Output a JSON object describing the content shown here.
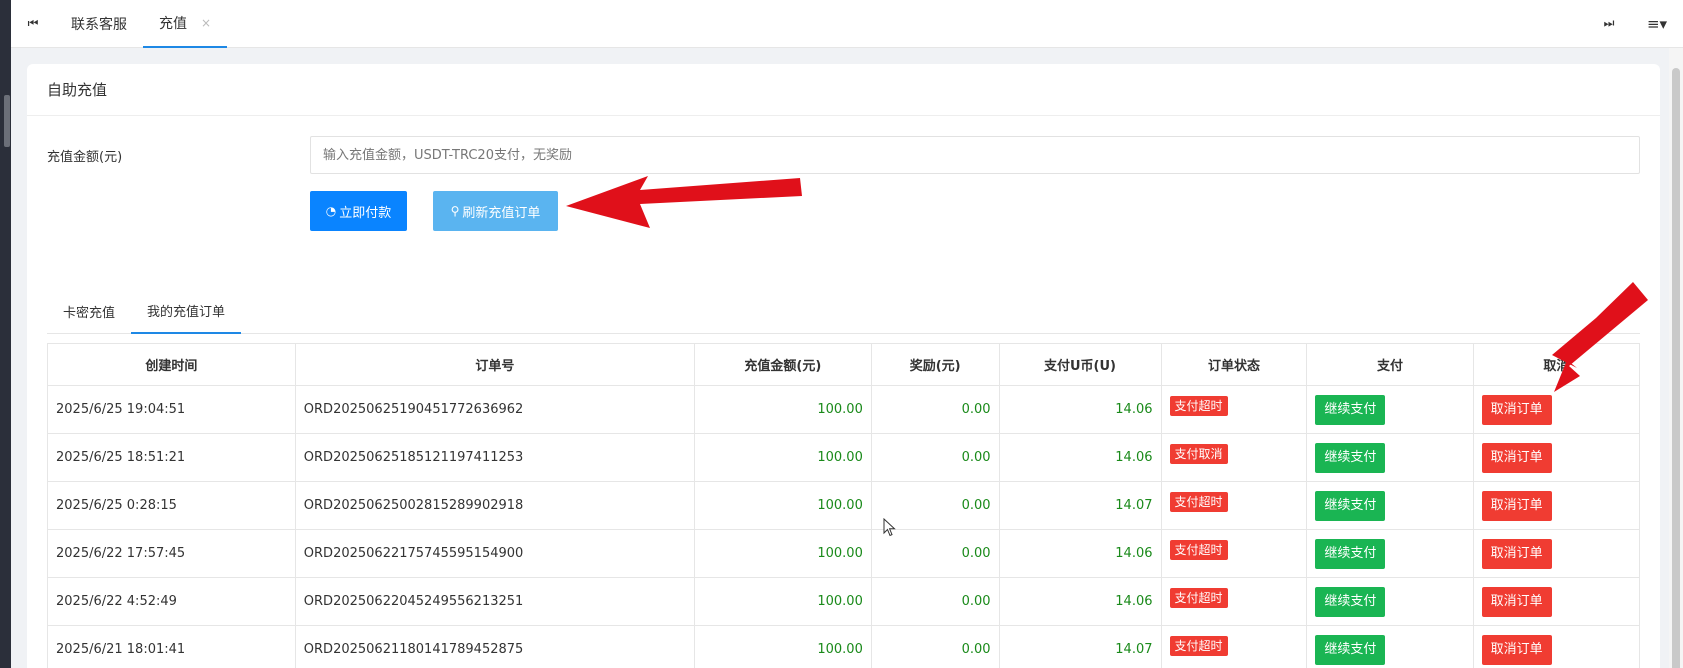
{
  "tabbar": {
    "first_icon": "⏮",
    "tabs": [
      {
        "label": "联系客服"
      },
      {
        "label": "充值",
        "close": "×"
      }
    ],
    "last_icon": "⏭",
    "menu_icon": "≡▾"
  },
  "card": {
    "title": "自助充值",
    "form": {
      "amount_label": "充值金额(元)",
      "amount_placeholder": "输入充值金额，USDT-TRC20支付，无奖励"
    },
    "buttons": {
      "pay_icon": "◔",
      "pay": "立即付款",
      "refresh_icon": "⚲",
      "refresh": "刷新充值订单"
    },
    "subtabs": [
      {
        "label": "卡密充值"
      },
      {
        "label": "我的充值订单"
      }
    ]
  },
  "table": {
    "headers": [
      "创建时间",
      "订单号",
      "充值金额(元)",
      "奖励(元)",
      "支付U币(U)",
      "订单状态",
      "支付",
      "取消"
    ],
    "rows": [
      {
        "time": "2025/6/25 19:04:51",
        "order": "ORD20250625190451772636962",
        "amount": "100.00",
        "reward": "0.00",
        "usdt": "14.06",
        "status": "支付超时",
        "pay": "继续支付",
        "cancel": "取消订单"
      },
      {
        "time": "2025/6/25 18:51:21",
        "order": "ORD20250625185121197411253",
        "amount": "100.00",
        "reward": "0.00",
        "usdt": "14.06",
        "status": "支付取消",
        "pay": "继续支付",
        "cancel": "取消订单"
      },
      {
        "time": "2025/6/25 0:28:15",
        "order": "ORD20250625002815289902918",
        "amount": "100.00",
        "reward": "0.00",
        "usdt": "14.07",
        "status": "支付超时",
        "pay": "继续支付",
        "cancel": "取消订单"
      },
      {
        "time": "2025/6/22 17:57:45",
        "order": "ORD20250622175745595154900",
        "amount": "100.00",
        "reward": "0.00",
        "usdt": "14.06",
        "status": "支付超时",
        "pay": "继续支付",
        "cancel": "取消订单"
      },
      {
        "time": "2025/6/22 4:52:49",
        "order": "ORD20250622045249556213251",
        "amount": "100.00",
        "reward": "0.00",
        "usdt": "14.06",
        "status": "支付超时",
        "pay": "继续支付",
        "cancel": "取消订单"
      },
      {
        "time": "2025/6/21 18:01:41",
        "order": "ORD20250621180141789452875",
        "amount": "100.00",
        "reward": "0.00",
        "usdt": "14.07",
        "status": "支付超时",
        "pay": "继续支付",
        "cancel": "取消订单"
      }
    ]
  },
  "colors": {
    "primary": "#0a84ff",
    "refresh": "#5ab4f0",
    "success_text": "#1a8a1a",
    "danger": "#f03c32",
    "green_button": "#1ab553",
    "annotation_arrow": "#e0101a"
  }
}
